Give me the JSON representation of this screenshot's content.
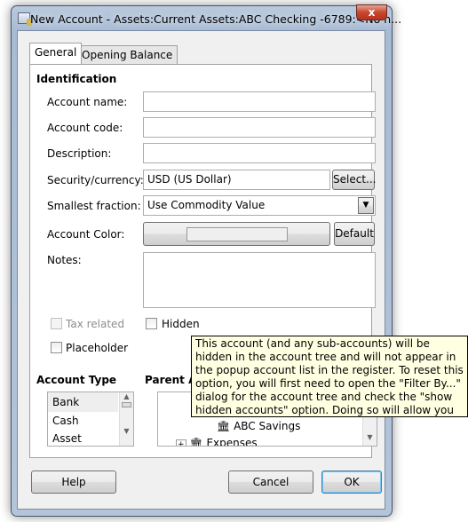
{
  "window": {
    "title": "New Account - Assets:Current Assets:ABC Checking -6789:<No n...",
    "close": "x"
  },
  "tabs": [
    {
      "label": "General"
    },
    {
      "label": "Opening Balance"
    }
  ],
  "identification": {
    "heading": "Identification",
    "account_name": {
      "label": "Account name:",
      "value": ""
    },
    "account_code": {
      "label": "Account code:",
      "value": ""
    },
    "description": {
      "label": "Description:",
      "value": ""
    },
    "security": {
      "label": "Security/currency:",
      "value": "USD (US Dollar)",
      "button": "Select..."
    },
    "fraction": {
      "label": "Smallest fraction:",
      "value": "Use Commodity Value"
    },
    "color": {
      "label": "Account Color:",
      "button": "Default"
    },
    "notes": {
      "label": "Notes:",
      "value": ""
    }
  },
  "checkboxes": {
    "tax_related": {
      "label": "Tax related",
      "checked": false,
      "disabled": true
    },
    "hidden": {
      "label": "Hidden",
      "checked": false
    },
    "placeholder": {
      "label": "Placeholder",
      "checked": false
    }
  },
  "tooltip": "This account (and any sub-accounts) will be hidden in the account tree and will not appear in the popup account list in the register.  To reset this option, you will first need to open the \"Filter By...\" dialog for the account tree and check the \"show hidden accounts\" option.  Doing so will allow you to select the account and reopen this dialog.",
  "account_type": {
    "heading": "Account Type",
    "items": [
      "Bank",
      "Cash",
      "Asset"
    ],
    "selected": "Bank"
  },
  "parent_account": {
    "heading": "Parent Account",
    "items": [
      "ABC Savings",
      "Expenses"
    ]
  },
  "buttons": {
    "help": "Help",
    "cancel": "Cancel",
    "ok": "OK"
  }
}
